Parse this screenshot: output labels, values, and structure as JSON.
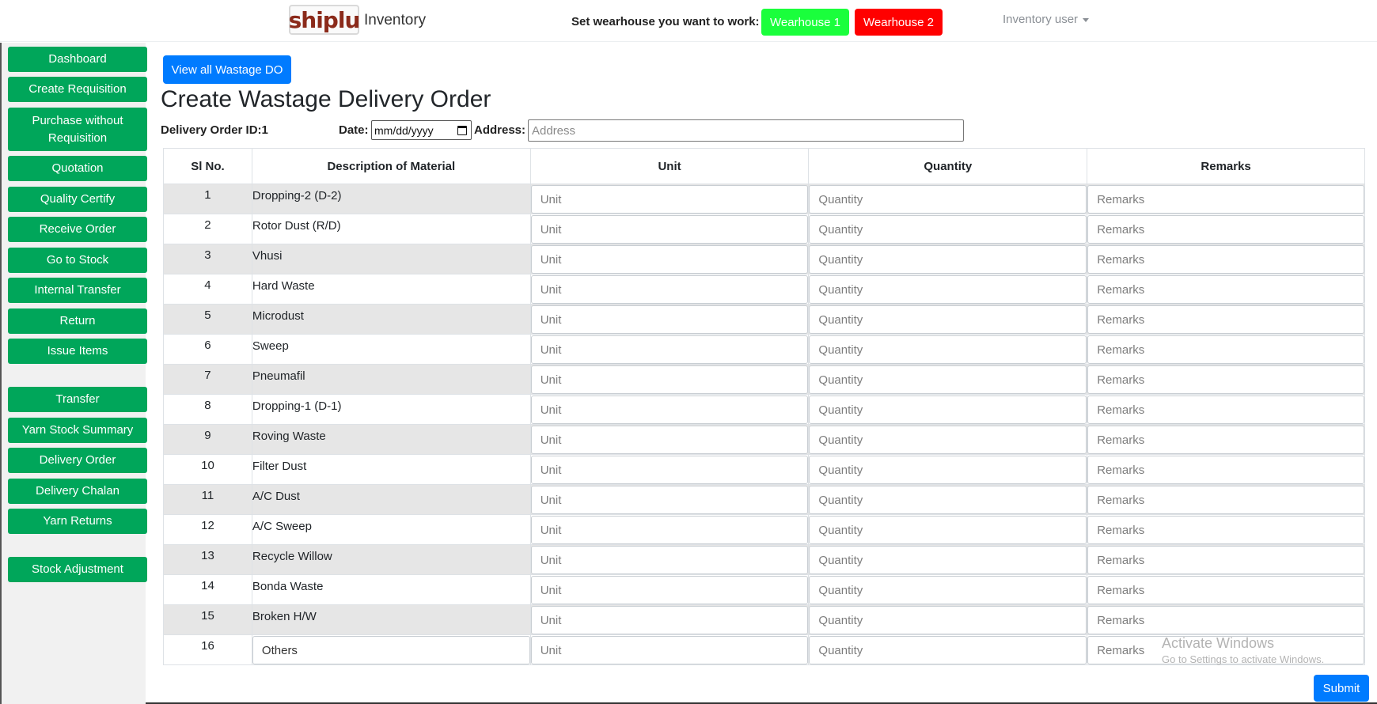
{
  "header": {
    "logo_text": "shiplu",
    "brand": "Inventory",
    "warehouse_prompt": "Set wearhouse you want to work:",
    "warehouse_buttons": [
      "Wearhouse 1",
      "Wearhouse 2"
    ],
    "warehouse_colors": [
      "#1aff3c",
      "#ff0000"
    ],
    "user_menu": "Inventory user"
  },
  "sidebar": {
    "items": [
      "Dashboard",
      "Create Requisition",
      "Purchase without Requisition",
      "Quotation",
      "Quality Certify",
      "Receive Order",
      "Go to Stock",
      "Internal Transfer",
      "Return",
      "Issue Items",
      "Transfer",
      "Yarn Stock Summary",
      "Delivery Order",
      "Delivery Chalan",
      "Yarn Returns",
      "Stock Adjustment"
    ],
    "accent": "#00a65a"
  },
  "main": {
    "view_all_label": "View all Wastage DO",
    "title": "Create Wastage Delivery Order",
    "delivery_order_label": "Delivery Order ID:1",
    "date_label": "Date:",
    "date_placeholder": "mm/dd/yyyy",
    "address_label": "Address:",
    "address_placeholder": "Address",
    "submit_label": "Submit"
  },
  "table": {
    "headers": [
      "Sl No.",
      "Description of Material",
      "Unit",
      "Quantity",
      "Remarks"
    ],
    "placeholders": {
      "unit": "Unit",
      "quantity": "Quantity",
      "remarks": "Remarks"
    },
    "rows": [
      {
        "sl": "1",
        "desc": "Dropping-2 (D-2)"
      },
      {
        "sl": "2",
        "desc": "Rotor Dust (R/D)"
      },
      {
        "sl": "3",
        "desc": "Vhusi"
      },
      {
        "sl": "4",
        "desc": "Hard Waste"
      },
      {
        "sl": "5",
        "desc": "Microdust"
      },
      {
        "sl": "6",
        "desc": "Sweep"
      },
      {
        "sl": "7",
        "desc": "Pneumafil"
      },
      {
        "sl": "8",
        "desc": "Dropping-1 (D-1)"
      },
      {
        "sl": "9",
        "desc": "Roving Waste"
      },
      {
        "sl": "10",
        "desc": "Filter Dust"
      },
      {
        "sl": "11",
        "desc": "A/C Dust"
      },
      {
        "sl": "12",
        "desc": "A/C Sweep"
      },
      {
        "sl": "13",
        "desc": "Recycle Willow"
      },
      {
        "sl": "14",
        "desc": "Bonda Waste"
      },
      {
        "sl": "15",
        "desc": "Broken H/W"
      },
      {
        "sl": "16",
        "desc": "Others"
      }
    ]
  },
  "watermark": {
    "line1": "Activate Windows",
    "line2": "Go to Settings to activate Windows."
  }
}
